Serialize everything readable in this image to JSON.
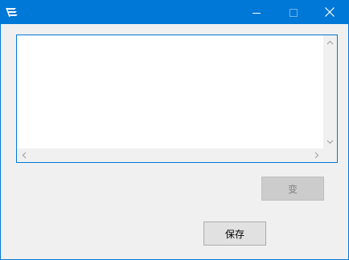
{
  "window": {
    "titlebar_color": "#0078d7",
    "icons": {
      "app": "app-logo-icon",
      "minimize": "minimize-icon",
      "maximize": "maximize-icon",
      "close": "close-icon"
    }
  },
  "textarea": {
    "value": ""
  },
  "buttons": {
    "change_label": "变",
    "save_label": "保存"
  }
}
